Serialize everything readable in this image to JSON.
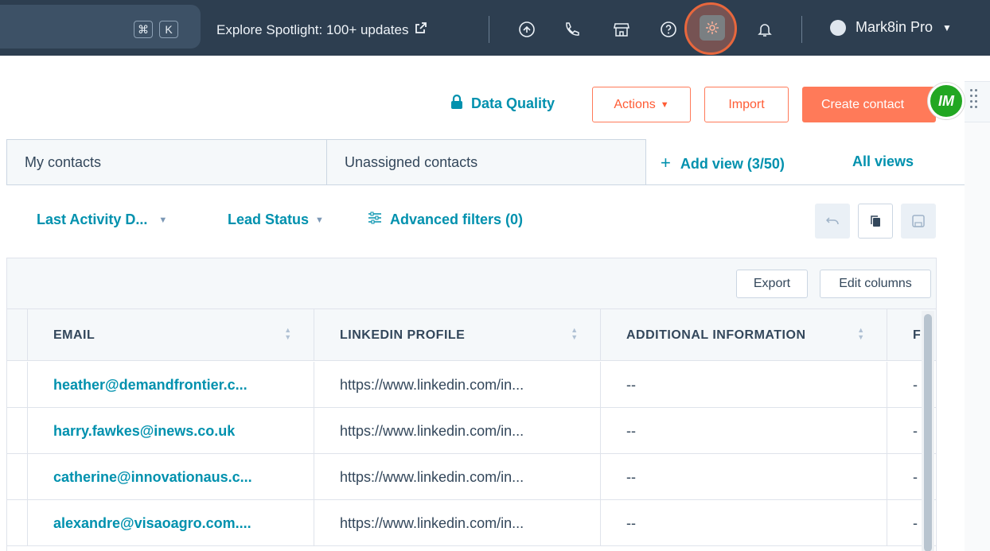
{
  "topbar": {
    "shortcut_keys": [
      "⌘",
      "K"
    ],
    "explore_text": "Explore Spotlight: 100+ updates",
    "icons": [
      "upgrade-icon",
      "phone-icon",
      "marketplace-icon",
      "help-icon",
      "gear-icon",
      "bell-icon"
    ],
    "account_name": "Mark8in Pro"
  },
  "header": {
    "data_quality": "Data Quality",
    "actions_label": "Actions",
    "import_label": "Import",
    "create_label": "Create contact",
    "badge_text": "IM"
  },
  "tabs": {
    "items": [
      {
        "label": "My contacts"
      },
      {
        "label": "Unassigned contacts"
      }
    ],
    "add_view": "Add view (3/50)",
    "all_views": "All views"
  },
  "filters": {
    "last_activity": "Last Activity D...",
    "lead_status": "Lead Status",
    "advanced": "Advanced filters (0)"
  },
  "table": {
    "export_label": "Export",
    "edit_columns_label": "Edit columns",
    "columns": [
      "EMAIL",
      "LINKEDIN PROFILE",
      "ADDITIONAL INFORMATION",
      "F"
    ],
    "rows": [
      {
        "email": "heather@demandfrontier.c...",
        "linkedin": "https://www.linkedin.com/in...",
        "info": "--",
        "extra": "-"
      },
      {
        "email": "harry.fawkes@inews.co.uk",
        "linkedin": "https://www.linkedin.com/in...",
        "info": "--",
        "extra": "-"
      },
      {
        "email": "catherine@innovationaus.c...",
        "linkedin": "https://www.linkedin.com/in...",
        "info": "--",
        "extra": "-"
      },
      {
        "email": "alexandre@visaoagro.com....",
        "linkedin": "https://www.linkedin.com/in...",
        "info": "--",
        "extra": "-"
      }
    ]
  },
  "colors": {
    "topbar": "#2d3e50",
    "accent_orange": "#ff7a59",
    "link_teal": "#0091ae",
    "badge_green": "#22a722"
  }
}
